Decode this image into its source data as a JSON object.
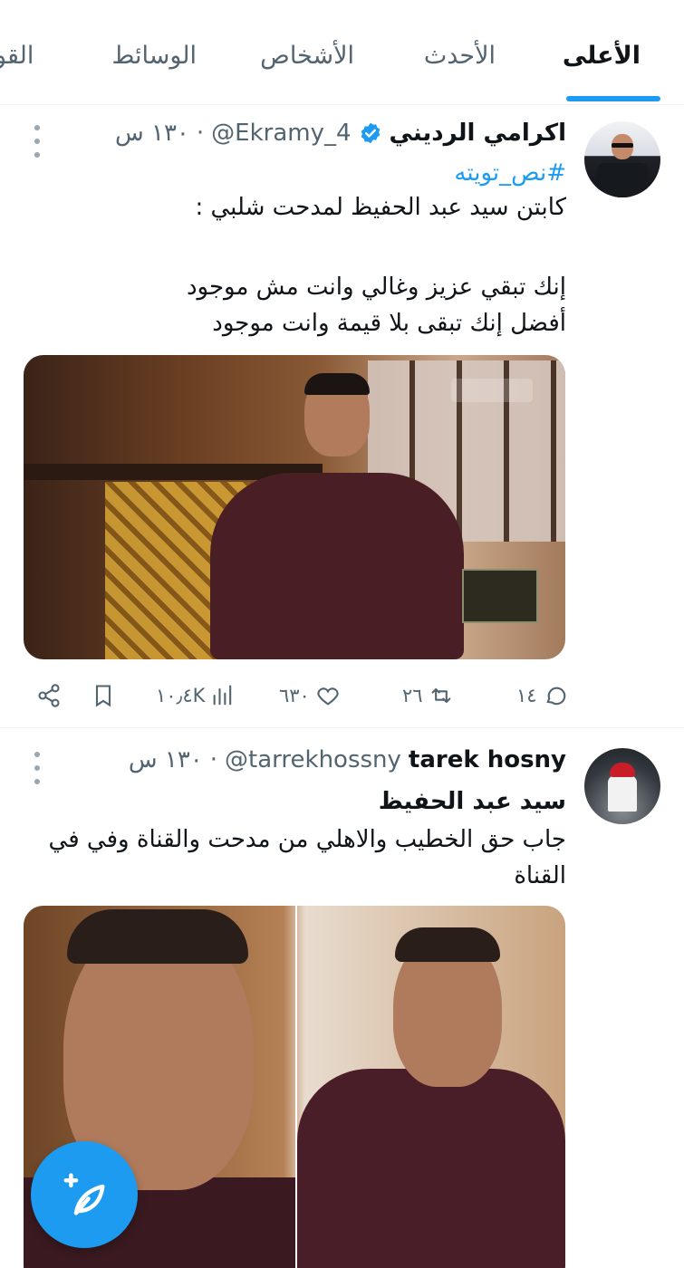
{
  "tabs": {
    "top": "الأعلى",
    "latest": "الأحدث",
    "people": "الأشخاص",
    "media": "الوسائط",
    "cut": "القو"
  },
  "tweets": [
    {
      "name": "اكرامي الرديني",
      "handle": "@Ekramy_4",
      "time": "١٣٠ س",
      "verified": true,
      "hashtag": "#نص_تويته",
      "line1": "كابتن سيد عبد الحفيظ لمدحت شلبي :",
      "line2": "إنك تبقي عزيز وغالي وانت مش موجود",
      "line3": "أفضل إنك تبقى بلا قيمة وانت موجود",
      "stats": {
        "replies": "١٤",
        "retweets": "٢٦",
        "likes": "٦٣٠",
        "views": "١٠٫٤K"
      }
    },
    {
      "name": "tarek hosny",
      "handle": "@tarrekhossny",
      "time": "١٣٠ س",
      "line1": "سيد عبد الحفيظ",
      "line2": "جاب حق الخطيب والاهلي من مدحت والقناة وفي في",
      "line3": "القناة"
    }
  ],
  "colors": {
    "accent": "#1d9bf0",
    "text": "#0f1419",
    "secondary": "#536471"
  },
  "icons": {
    "verified": "verified-badge-icon",
    "more": "more-vertical-icon",
    "reply": "reply-icon",
    "retweet": "retweet-icon",
    "like": "heart-icon",
    "views": "views-icon",
    "bookmark": "bookmark-icon",
    "share": "share-icon",
    "compose": "compose-icon"
  }
}
